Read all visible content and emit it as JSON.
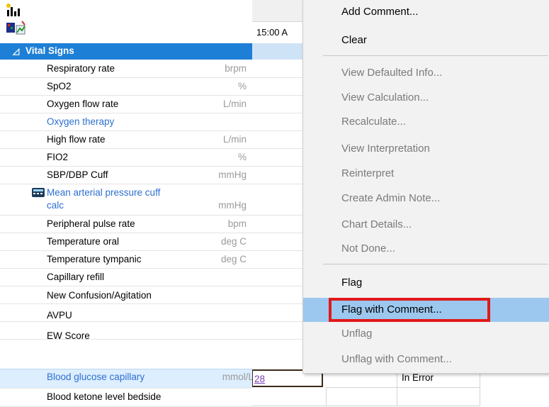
{
  "grid": {
    "time_header": "15:00 A",
    "section_label": "Vital Signs",
    "rows": [
      {
        "label": "Respiratory rate",
        "unit": "brpm"
      },
      {
        "label": "SpO2",
        "unit": "%"
      },
      {
        "label": "Oxygen flow rate",
        "unit": "L/min"
      },
      {
        "label": "Oxygen therapy",
        "unit": ""
      },
      {
        "label": "High flow rate",
        "unit": "L/min"
      },
      {
        "label": "FIO2",
        "unit": "%"
      },
      {
        "label": "SBP/DBP Cuff",
        "unit": "mmHg"
      },
      {
        "label": "Mean arterial pressure cuff",
        "label2": "calc",
        "unit": "mmHg"
      },
      {
        "label": "Peripheral pulse rate",
        "unit": "bpm"
      },
      {
        "label": "Temperature oral",
        "unit": "deg C"
      },
      {
        "label": "Temperature tympanic",
        "unit": "deg C"
      },
      {
        "label": "Capillary refill",
        "unit": ""
      },
      {
        "label": "New Confusion/Agitation",
        "unit": ""
      },
      {
        "label": "AVPU",
        "unit": ""
      },
      {
        "label": "EW Score",
        "unit": ""
      },
      {
        "label": "Blood glucose capillary",
        "unit": "mmol/L",
        "value": "28",
        "status": "In Error"
      },
      {
        "label": "Blood ketone level bedside",
        "unit": ""
      }
    ]
  },
  "context_menu": {
    "items": [
      {
        "label": "Add Comment...",
        "enabled": true
      },
      {
        "label": "Clear",
        "enabled": true
      },
      {
        "label": "View Defaulted Info...",
        "enabled": false
      },
      {
        "label": "View Calculation...",
        "enabled": false
      },
      {
        "label": "Recalculate...",
        "enabled": false
      },
      {
        "label": "View Interpretation",
        "enabled": false
      },
      {
        "label": "Reinterpret",
        "enabled": false
      },
      {
        "label": "Create Admin Note...",
        "enabled": false
      },
      {
        "label": "Chart Details...",
        "enabled": false
      },
      {
        "label": "Not Done...",
        "enabled": false
      },
      {
        "label": "Flag",
        "enabled": true
      },
      {
        "label": "Flag with Comment...",
        "enabled": true,
        "highlighted": true
      },
      {
        "label": "Unflag",
        "enabled": false
      },
      {
        "label": "Unflag with Comment...",
        "enabled": false
      }
    ]
  },
  "colors": {
    "section_bg": "#1e7fd6",
    "highlight_box": "#e01a1a",
    "menu_highlight": "#9cc8ef",
    "link_blue": "#2d6fd0"
  }
}
